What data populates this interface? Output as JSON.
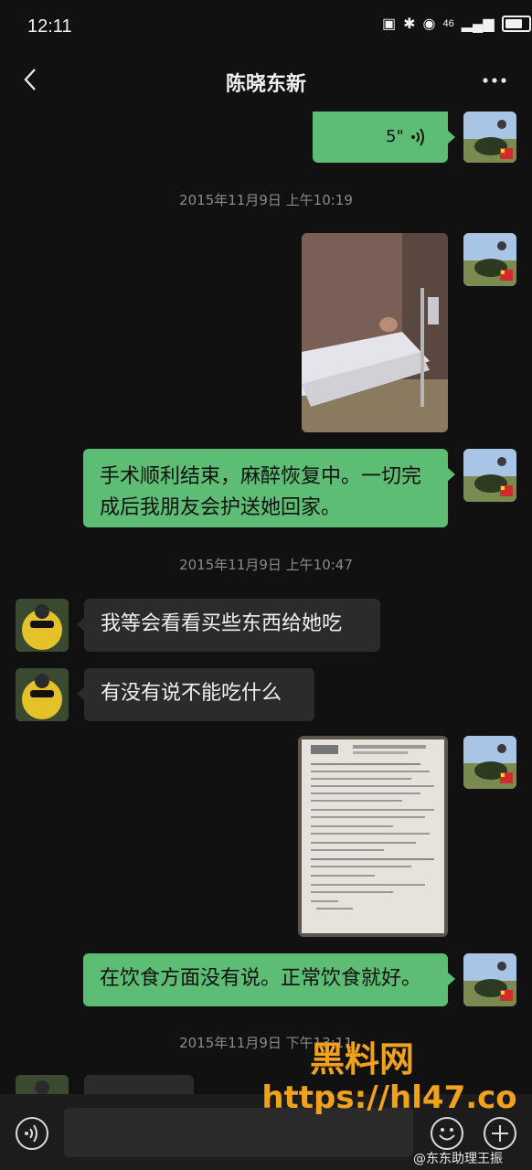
{
  "status_bar": {
    "time": "12:11",
    "icons": [
      "nfc-icon",
      "bluetooth-icon",
      "4g-signal-icon",
      "hotspot-icon",
      "signal-icon",
      "battery-icon"
    ],
    "network": "46"
  },
  "header": {
    "title": "陈晓东新"
  },
  "messages": {
    "voice": {
      "duration": "5\""
    },
    "ts1": "2015年11月9日  上午10:19",
    "m1": "手术顺利结束，麻醉恢复中。一切完成后我朋友会护送她回家。",
    "ts2": "2015年11月9日  上午10:47",
    "m2": "我等会看看买些东西给她吃",
    "m3": "有没有说不能吃什么",
    "m4": "在饮食方面没有说。正常饮食就好。",
    "ts3": "2015年11月9日  下午13:11"
  },
  "watermark": {
    "line1": "黑料网",
    "line2": "https://hl47.co"
  },
  "credit": "@东东助理王振",
  "colors": {
    "bubble_green": "#5dbd74",
    "bubble_dark": "#2b2b2b",
    "background": "#111111",
    "watermark": "#f1a21c"
  }
}
